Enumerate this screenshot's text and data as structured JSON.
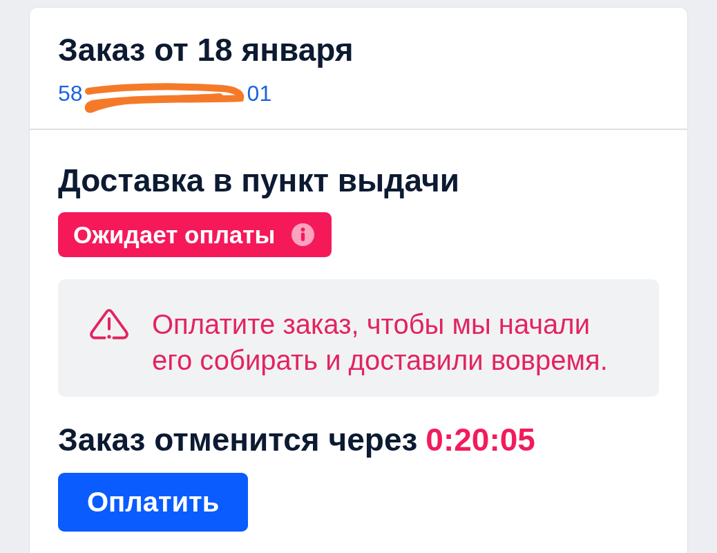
{
  "order": {
    "title": "Заказ от 18 января",
    "number_visible_start": "58",
    "number_visible_end": "01"
  },
  "delivery": {
    "title": "Доставка в пункт выдачи",
    "status": {
      "label": "Ожидает оплаты"
    }
  },
  "alert": {
    "text": "Оплатите заказ, чтобы мы начали его собирать и доставили вовремя."
  },
  "cancel": {
    "label": "Заказ отменится через",
    "timer": "0:20:05"
  },
  "pay_button": {
    "label": "Оплатить"
  }
}
